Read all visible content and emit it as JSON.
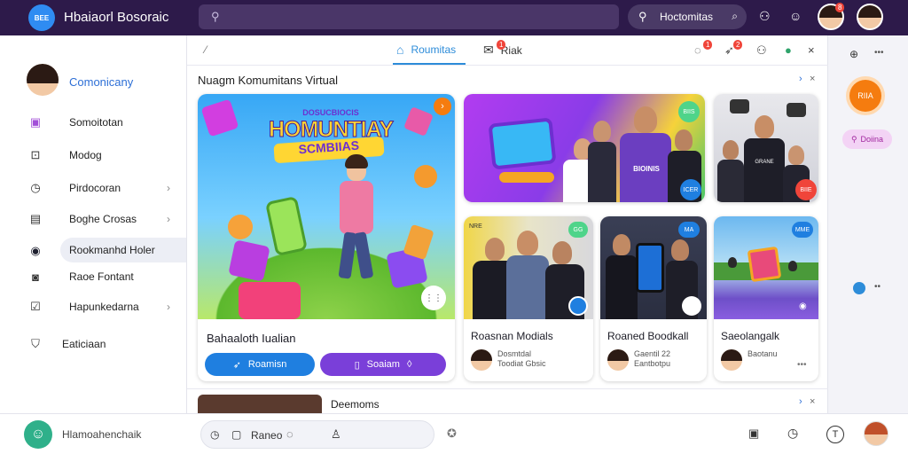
{
  "app": {
    "title": "Hbaiaorl Bosoraic",
    "logo_text": "BEE"
  },
  "topbar": {
    "search_pill_label": "Hoctomitas",
    "notif_count": "8"
  },
  "sidebar": {
    "profile_name": "Comonicany",
    "items": [
      {
        "label": "Somoitotan",
        "icon": "calendar-icon",
        "chevron": false
      },
      {
        "label": "Modog",
        "icon": "bag-icon",
        "chevron": false
      },
      {
        "label": "Pirdocoran",
        "icon": "clock-icon",
        "chevron": true
      },
      {
        "label": "Boghe Crosas",
        "icon": "tv-icon",
        "chevron": true
      },
      {
        "label": "Rookmanhd Holer",
        "icon": "record-icon",
        "chevron": false,
        "active": true
      },
      {
        "label": "Raoe Fontant",
        "icon": "box-icon",
        "chevron": false
      },
      {
        "label": "Hapunkedarna",
        "icon": "check-icon",
        "chevron": true
      },
      {
        "label": "Eaticiaan",
        "icon": "shield-icon",
        "chevron": false
      }
    ]
  },
  "tabs": [
    {
      "label": "Roumitas",
      "active": true
    },
    {
      "label": "Riak",
      "active": false
    }
  ],
  "tab_badges": {
    "riak": "1",
    "act1": "1",
    "act2": "2"
  },
  "panel": {
    "title": "Nuagm Komumitans Virtual",
    "featured": {
      "banner_line1": "HOMUNTIAY",
      "banner_line2": "SCMBIIAS",
      "banner_small": "DOSUCBIOCIS",
      "title": "Bahaaloth Iualian",
      "btn_primary": "Roamisn",
      "btn_secondary": "Soaiam"
    },
    "cards": [
      {
        "title": "Roasnan Modials",
        "meta1": "Dosmtdal",
        "meta2": "Toodiat Gbsic",
        "badge": "GG",
        "tag": "NRE"
      },
      {
        "title": "Roaned Boodkall",
        "meta1": "Gaentil 22",
        "meta2": "Eantbotpu",
        "badge": "MA",
        "tag": "ARIE"
      },
      {
        "title": "Saeolangalk",
        "meta1": "Baotanu",
        "meta2": "",
        "badge": "P",
        "tag": "MME"
      }
    ],
    "top_cards": [
      {
        "tag": "BIIS",
        "corner": "ICER",
        "shirt_text": "BIOINIS"
      },
      {
        "tag": "ELE",
        "corner": "BIIE",
        "shirt_text": "GRANE"
      }
    ],
    "next_title": "Deemoms"
  },
  "rail": {
    "orange_button": "RIIA",
    "pill_label": "Doiina"
  },
  "bottombar": {
    "user_label": "Hlamoahenchaik",
    "reply_label": "Raneo"
  },
  "colors": {
    "topbar": "#2d1a4a",
    "accent_blue": "#2d8cd9",
    "btn_blue": "#1f7fe0",
    "btn_purple": "#7a3fd9",
    "orange": "#f57c0f"
  }
}
